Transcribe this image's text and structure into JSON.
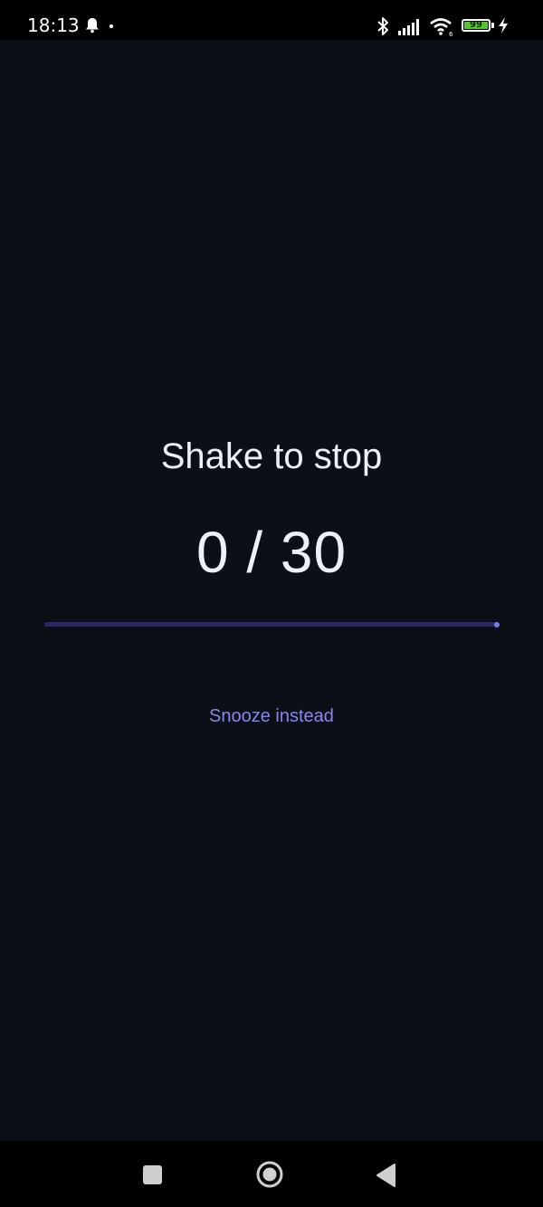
{
  "status_bar": {
    "time": "18:13",
    "battery_level": "99",
    "battery_percent": 99,
    "icons": [
      "notification-bell-icon",
      "dot-icon",
      "bluetooth-icon",
      "signal-icon",
      "wifi-icon",
      "battery-icon",
      "charging-bolt-icon"
    ]
  },
  "main": {
    "title": "Shake to stop",
    "counter": "0 / 30",
    "progress_fraction": 0.0,
    "snooze_label": "Snooze instead"
  },
  "nav_bar": {
    "icons": [
      "recents-icon",
      "home-icon",
      "back-icon"
    ]
  },
  "colors": {
    "background": "#0d0f17",
    "text": "#eef0f6",
    "accent": "#8587f2",
    "progress_track": "#2a2b66",
    "battery_fill": "#55c62d"
  }
}
